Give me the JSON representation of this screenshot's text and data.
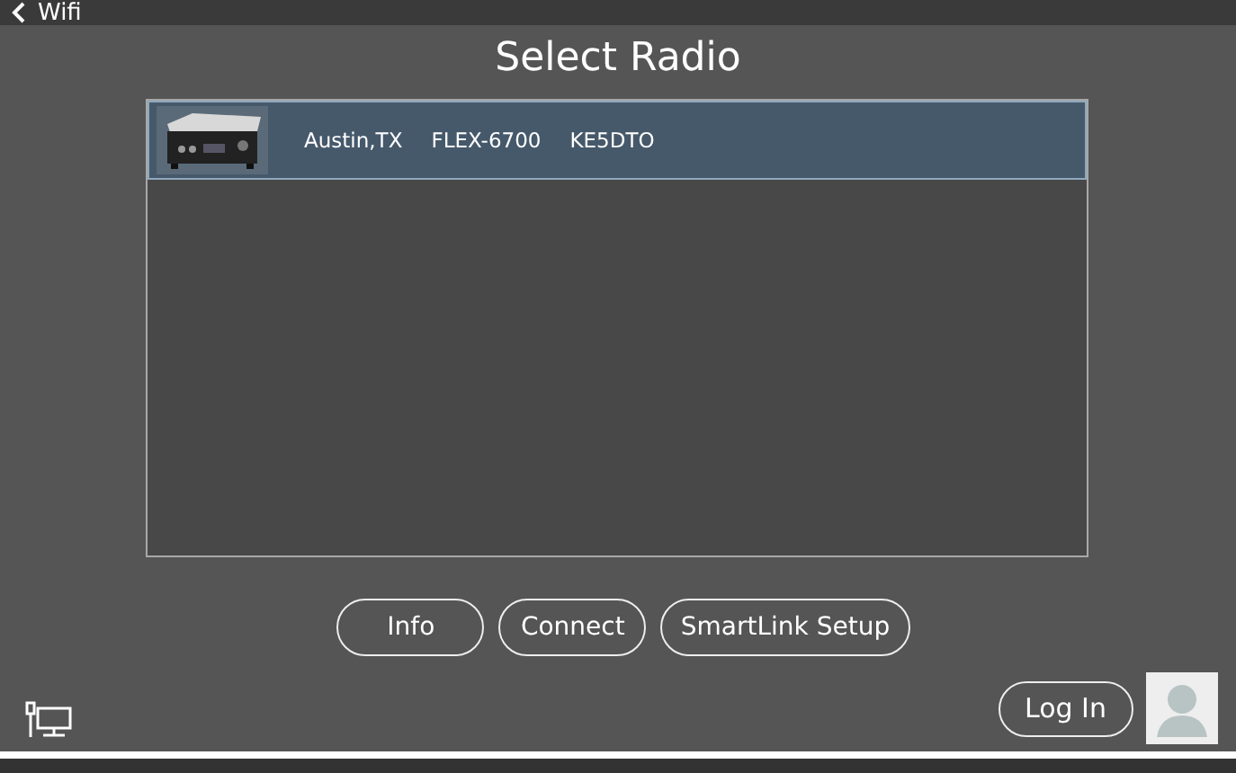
{
  "back": {
    "label": "Wifi"
  },
  "title": "Select Radio",
  "radios": [
    {
      "location": "Austin,TX",
      "model": "FLEX-6700",
      "callsign": "KE5DTO",
      "selected": true
    }
  ],
  "buttons": [
    "Info",
    "Connect",
    "SmartLink Setup"
  ],
  "login": {
    "label": "Log In"
  }
}
